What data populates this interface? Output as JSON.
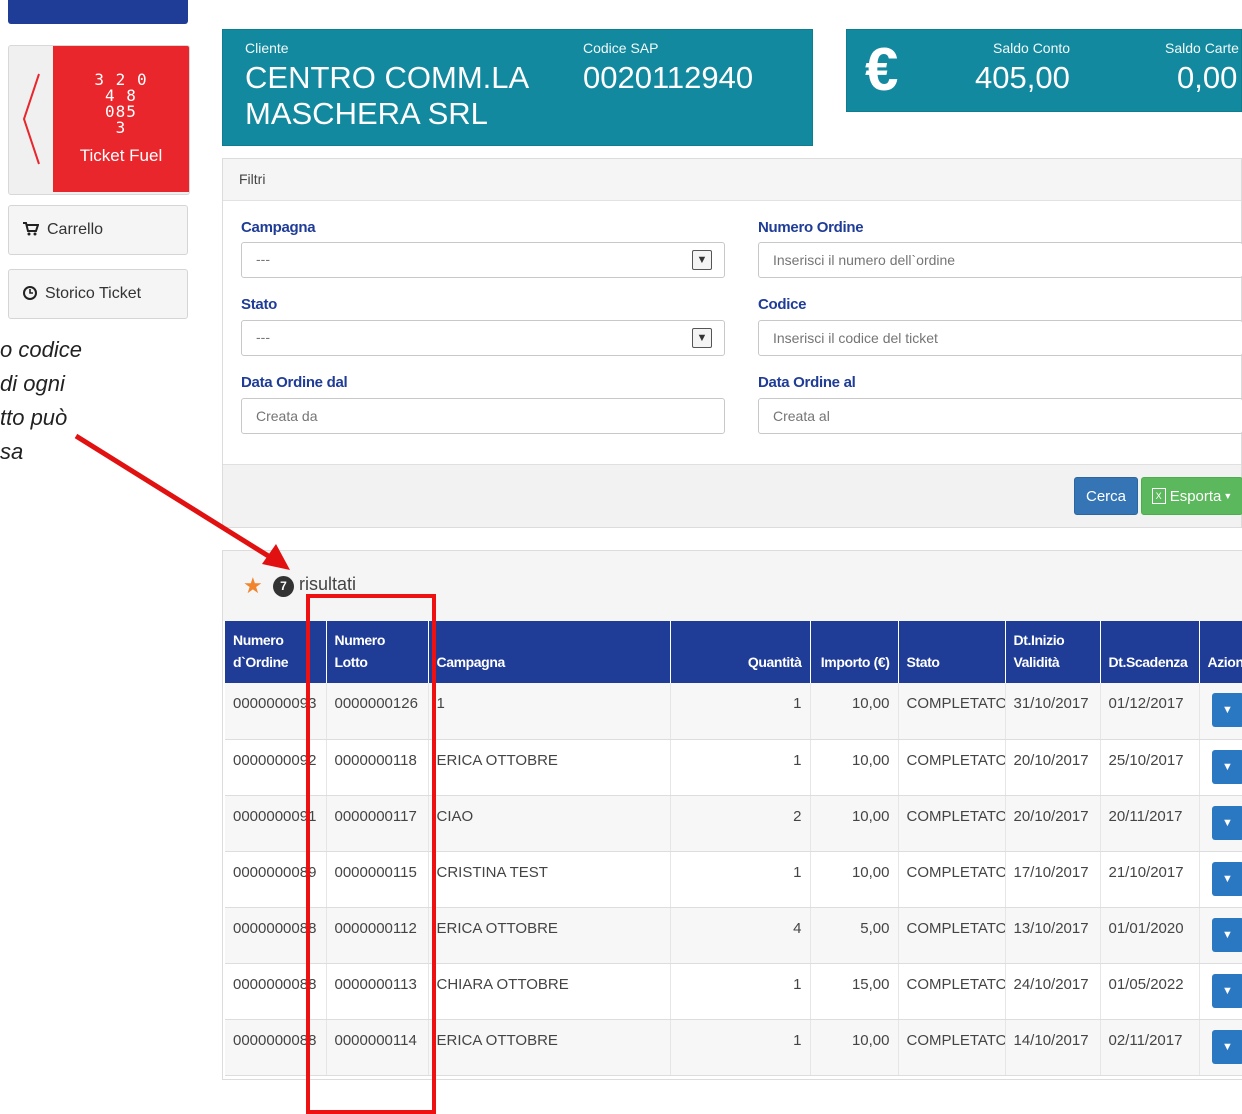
{
  "sidebar": {
    "ticket_label": "Ticket Fuel",
    "ticket_glyphs": "3 2 0\n4 8\n085\n3",
    "cart_label": "Carrello",
    "history_label": "Storico Ticket"
  },
  "note_lines": [
    "o codice",
    "di ogni",
    "tto può",
    "sa"
  ],
  "client": {
    "label": "Cliente",
    "name_line1": "CENTRO COMM.LA",
    "name_line2": "MASCHERA SRL",
    "sap_label": "Codice SAP",
    "sap_value": "0020112940"
  },
  "balance": {
    "currency_symbol": "€",
    "account_label": "Saldo Conto",
    "account_value": "405,00",
    "cards_label": "Saldo Carte",
    "cards_value": "0,00"
  },
  "filters": {
    "title": "Filtri",
    "campaign_label": "Campagna",
    "campaign_value": "---",
    "order_number_label": "Numero Ordine",
    "order_number_placeholder": "Inserisci il numero dell`ordine",
    "status_label": "Stato",
    "status_value": "---",
    "code_label": "Codice",
    "code_placeholder": "Inserisci il codice del ticket",
    "date_from_label": "Data Ordine dal",
    "date_from_placeholder": "Creata da",
    "date_to_label": "Data Ordine al",
    "date_to_placeholder": "Creata al",
    "search_button": "Cerca",
    "export_button": "Esporta"
  },
  "results": {
    "count": "7",
    "label": "risultati",
    "columns": [
      "Numero d`Ordine",
      "Numero Lotto",
      "Campagna",
      "Quantità",
      "Importo (€)",
      "Stato",
      "Dt.Inizio Validità",
      "Dt.Scadenza",
      "Azioni"
    ],
    "rows": [
      {
        "order": "0000000093",
        "lot": "0000000126",
        "campaign": "1",
        "qty": "1",
        "amount": "10,00",
        "status": "COMPLETATO",
        "start": "31/10/2017",
        "end": "01/12/2017"
      },
      {
        "order": "0000000092",
        "lot": "0000000118",
        "campaign": "ERICA OTTOBRE",
        "qty": "1",
        "amount": "10,00",
        "status": "COMPLETATO",
        "start": "20/10/2017",
        "end": "25/10/2017"
      },
      {
        "order": "0000000091",
        "lot": "0000000117",
        "campaign": "CIAO",
        "qty": "2",
        "amount": "10,00",
        "status": "COMPLETATO",
        "start": "20/10/2017",
        "end": "20/11/2017"
      },
      {
        "order": "0000000089",
        "lot": "0000000115",
        "campaign": "CRISTINA TEST",
        "qty": "1",
        "amount": "10,00",
        "status": "COMPLETATO",
        "start": "17/10/2017",
        "end": "21/10/2017"
      },
      {
        "order": "0000000088",
        "lot": "0000000112",
        "campaign": "ERICA OTTOBRE",
        "qty": "4",
        "amount": "5,00",
        "status": "COMPLETATO",
        "start": "13/10/2017",
        "end": "01/01/2020"
      },
      {
        "order": "0000000088",
        "lot": "0000000113",
        "campaign": "CHIARA OTTOBRE",
        "qty": "1",
        "amount": "15,00",
        "status": "COMPLETATO",
        "start": "24/10/2017",
        "end": "01/05/2022"
      },
      {
        "order": "0000000088",
        "lot": "0000000114",
        "campaign": "ERICA OTTOBRE",
        "qty": "1",
        "amount": "10,00",
        "status": "COMPLETATO",
        "start": "14/10/2017",
        "end": "02/11/2017"
      }
    ]
  },
  "colors": {
    "brand": "#1f3c97",
    "teal": "#12899e",
    "ticket_red": "#e8262c",
    "annotation": "#e11111"
  }
}
